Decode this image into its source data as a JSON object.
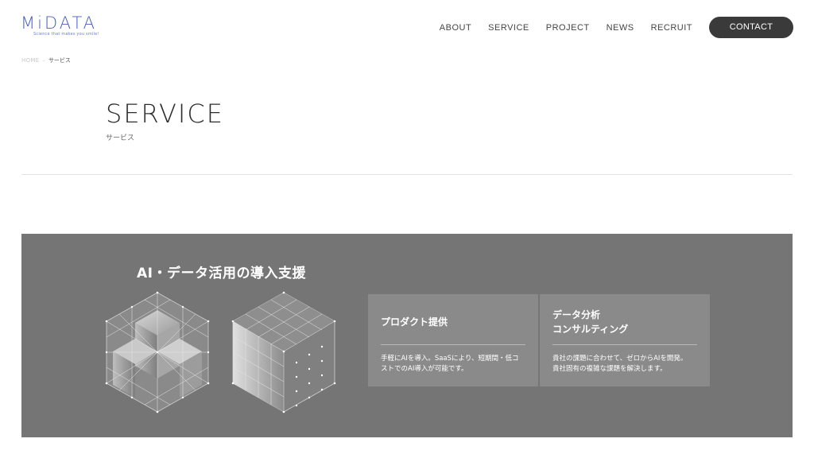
{
  "header": {
    "logo_text": "MiDATA",
    "logo_tagline": "Science that makes you smile!",
    "nav": [
      "ABOUT",
      "SERVICE",
      "PROJECT",
      "NEWS",
      "RECRUIT"
    ],
    "contact_label": "CONTACT"
  },
  "breadcrumb": {
    "home": "HOME",
    "separator": "–",
    "current": "サービス"
  },
  "hero": {
    "title": "SERVICE",
    "subtitle": "サービス"
  },
  "panel": {
    "title": "AI・データ活用の導入支援",
    "cards": [
      {
        "title": "プロダクト提供",
        "desc": "手軽にAIを導入。SaaSにより、短期間・低コストでのAI導入が可能です。"
      },
      {
        "title_line1": "データ分析",
        "title_line2": "コンサルティング",
        "desc_line1": "貴社の課題に合わせて、ゼロからAIを開発。",
        "desc_line2": "貴社固有の複雑な課題を解決します。"
      }
    ]
  },
  "colors": {
    "panel_bg": "#757575",
    "card_bg": "#8a8a8a",
    "contact_bg": "#3a3a3a",
    "logo": "#4a5fb0"
  },
  "icons": [
    "cube-blocks-illustration",
    "cube-grid-illustration"
  ]
}
